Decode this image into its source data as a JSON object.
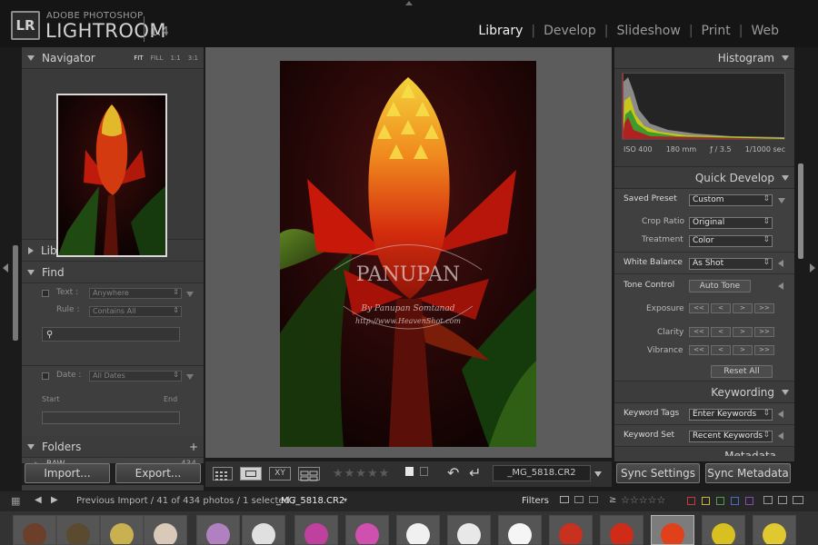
{
  "app": {
    "logo": "LR",
    "brand_top": "ADOBE PHOTOSHOP",
    "brand_main": "LIGHTROOM",
    "version": "1.4"
  },
  "modules": [
    {
      "label": "Library",
      "active": true
    },
    {
      "label": "Develop",
      "active": false
    },
    {
      "label": "Slideshow",
      "active": false
    },
    {
      "label": "Print",
      "active": false
    },
    {
      "label": "Web",
      "active": false
    }
  ],
  "left": {
    "navigator": {
      "title": "Navigator",
      "zoom": [
        "FIT",
        "FILL",
        "1:1",
        "3:1"
      ]
    },
    "library": {
      "title": "Library"
    },
    "find": {
      "title": "Find",
      "text_label": "Text :",
      "text_value": "Anywhere",
      "rule_label": "Rule :",
      "rule_value": "Contains All",
      "date_label": "Date :",
      "date_value": "All Dates",
      "start_label": "Start",
      "end_label": "End"
    },
    "folders": {
      "title": "Folders",
      "add": "+",
      "item": "RAW",
      "count": "434"
    },
    "import_label": "Import...",
    "export_label": "Export..."
  },
  "watermark": {
    "name": "PANUPAN",
    "by": "By Panupan Somtanad",
    "url": "http://www.HeavenShot.com"
  },
  "toolbar": {
    "filename": "_MG_5818.CR2",
    "stars": "★★★★★"
  },
  "right": {
    "histogram": {
      "title": "Histogram",
      "iso": "ISO 400",
      "focal": "180 mm",
      "aperture": "ƒ / 3.5",
      "shutter": "1/1000 sec"
    },
    "quick_develop": {
      "title": "Quick Develop",
      "saved_preset_label": "Saved Preset",
      "saved_preset_value": "Custom",
      "crop_label": "Crop Ratio",
      "crop_value": "Original",
      "treatment_label": "Treatment",
      "treatment_value": "Color",
      "wb_label": "White Balance",
      "wb_value": "As Shot",
      "tone_label": "Tone Control",
      "auto_tone": "Auto Tone",
      "exposure_label": "Exposure",
      "clarity_label": "Clarity",
      "vibrance_label": "Vibrance",
      "step_buttons": [
        "<<",
        "<",
        ">",
        ">>"
      ],
      "reset_all": "Reset All"
    },
    "keywording": {
      "title": "Keywording",
      "tags_label": "Keyword Tags",
      "tags_value": "Enter Keywords",
      "set_label": "Keyword Set",
      "set_value": "Recent Keywords"
    },
    "next_panel": "Metadata",
    "sync_settings": "Sync Settings",
    "sync_metadata": "Sync Metadata"
  },
  "filmbar": {
    "source": "Previous Import / 41 of 434 photos / 1 selected / ",
    "selected_file": "_MG_5818.CR2",
    "filters_label": "Filters",
    "filter_op": "≥",
    "filter_stars": "☆☆☆☆☆"
  },
  "colors": {
    "accent_bg": "#5c5c5c",
    "panel_bg": "#3c3c3c",
    "label_red": "#c23b3b",
    "label_yellow": "#c9b43a",
    "label_green": "#4aa04a",
    "label_blue": "#4a6fc0",
    "label_purple": "#8a4ab0"
  }
}
